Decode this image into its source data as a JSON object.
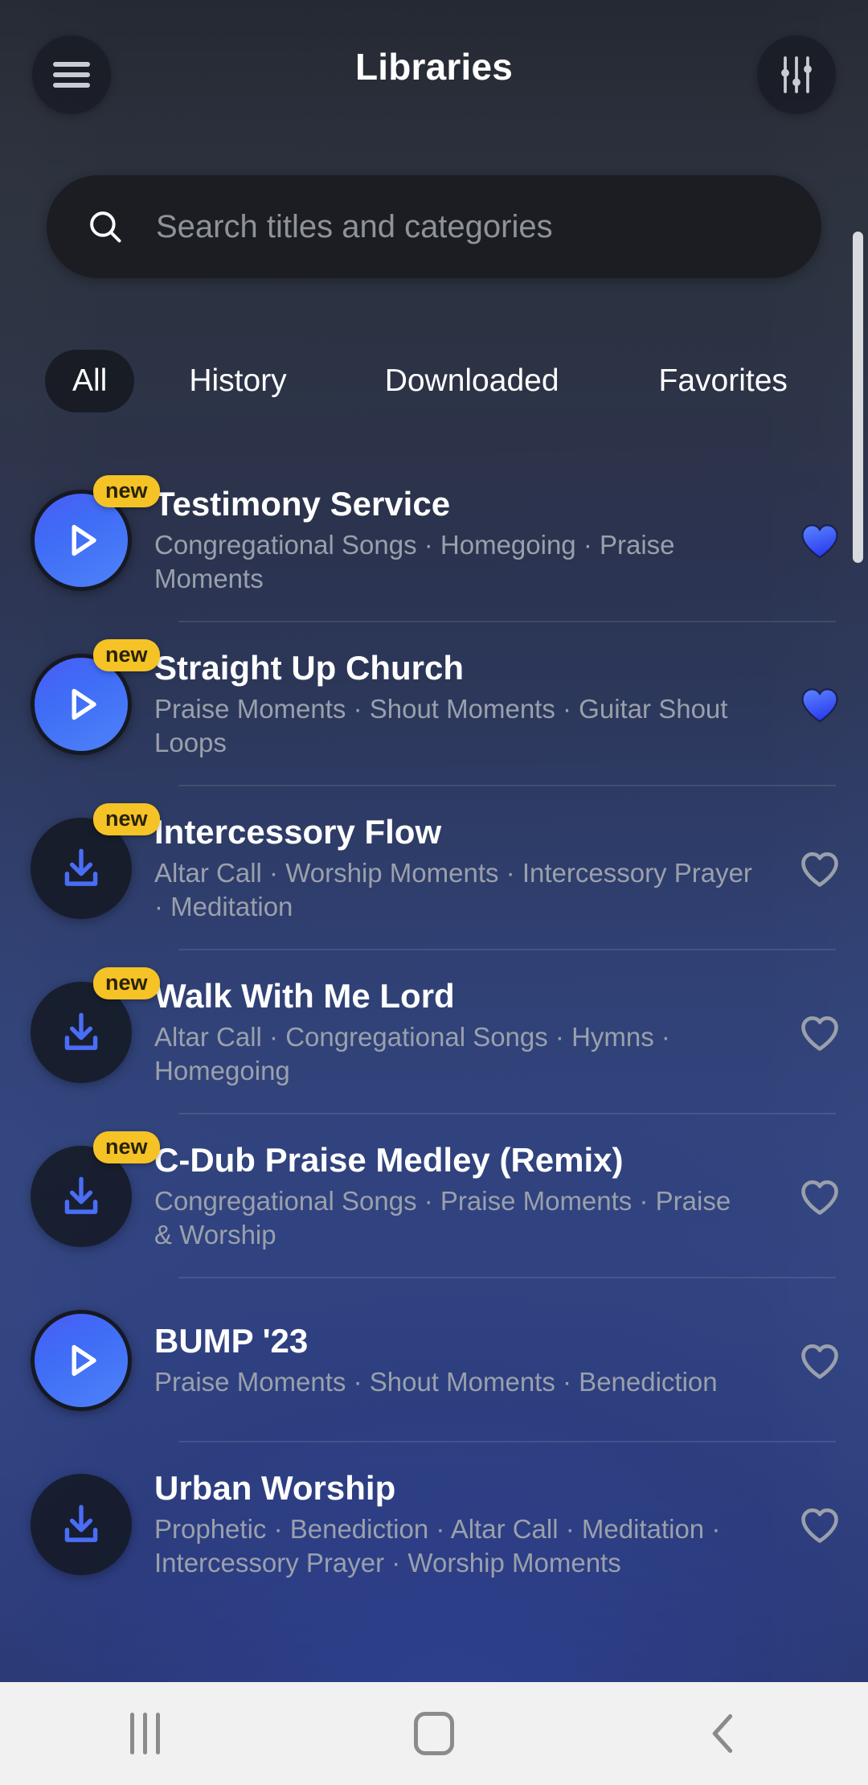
{
  "header": {
    "title": "Libraries",
    "menu_icon": "hamburger-menu-icon",
    "filter_icon": "sliders-filter-icon"
  },
  "search": {
    "placeholder": "Search titles and categories",
    "value": "",
    "icon": "search-icon"
  },
  "tabs": [
    {
      "label": "All",
      "active": true
    },
    {
      "label": "History",
      "active": false
    },
    {
      "label": "Downloaded",
      "active": false
    },
    {
      "label": "Favorites",
      "active": false
    }
  ],
  "colors": {
    "accent_blue": "#4a6df6",
    "badge_yellow": "#f5c325",
    "favorite_blue": "#3b6cf6",
    "muted_text": "#9aa0ab",
    "search_bg": "#1b1d22"
  },
  "list": [
    {
      "title": "Testimony Service",
      "categories": "Congregational Songs · Homegoing · Praise Moments",
      "badge": "new",
      "action_icon": "play-icon",
      "favorite": true,
      "favorite_icon": "heart-filled-icon"
    },
    {
      "title": "Straight Up Church",
      "categories": "Praise Moments · Shout Moments · Guitar Shout Loops",
      "badge": "new",
      "action_icon": "play-icon",
      "favorite": true,
      "favorite_icon": "heart-filled-icon"
    },
    {
      "title": "Intercessory Flow",
      "categories": "Altar Call · Worship Moments · Intercessory Prayer · Meditation",
      "badge": "new",
      "action_icon": "download-icon",
      "favorite": false,
      "favorite_icon": "heart-outline-icon"
    },
    {
      "title": "Walk With Me Lord",
      "categories": "Altar Call · Congregational Songs · Hymns · Homegoing",
      "badge": "new",
      "action_icon": "download-icon",
      "favorite": false,
      "favorite_icon": "heart-outline-icon"
    },
    {
      "title": "C-Dub Praise Medley (Remix)",
      "categories": "Congregational Songs · Praise Moments · Praise & Worship",
      "badge": "new",
      "action_icon": "download-icon",
      "favorite": false,
      "favorite_icon": "heart-outline-icon"
    },
    {
      "title": "BUMP '23",
      "categories": "Praise Moments · Shout Moments · Benediction",
      "badge": "",
      "action_icon": "play-icon",
      "favorite": false,
      "favorite_icon": "heart-outline-icon"
    },
    {
      "title": "Urban Worship",
      "categories": "Prophetic · Benediction · Altar Call · Meditation · Intercessory Prayer · Worship Moments",
      "badge": "",
      "action_icon": "download-icon",
      "favorite": false,
      "favorite_icon": "heart-outline-icon"
    }
  ],
  "navbar": {
    "recents_icon": "recents-icon",
    "home_icon": "home-icon",
    "back_icon": "back-icon"
  }
}
